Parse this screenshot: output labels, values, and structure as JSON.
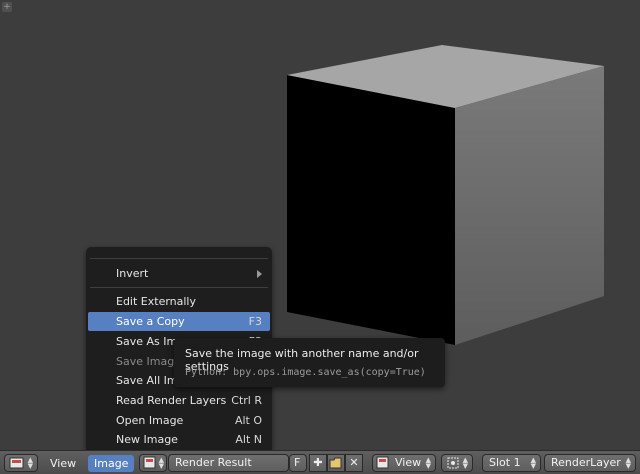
{
  "viewport": {
    "background": "#3d3d3d"
  },
  "menu": {
    "items": [
      {
        "label": "Invert",
        "shortcut": "",
        "submenu": true,
        "state": "normal"
      },
      {
        "label": "Edit Externally",
        "shortcut": "",
        "state": "normal"
      },
      {
        "label": "Save a Copy",
        "shortcut": "F3",
        "state": "active"
      },
      {
        "label": "Save As Image",
        "shortcut": "F3",
        "state": "normal"
      },
      {
        "label": "Save Image",
        "shortcut": "",
        "state": "disabled"
      },
      {
        "label": "Save All Images",
        "shortcut": "",
        "state": "normal"
      },
      {
        "label": "Read Render Layers",
        "shortcut": "Ctrl R",
        "state": "normal"
      },
      {
        "label": "Open Image",
        "shortcut": "Alt O",
        "state": "normal"
      },
      {
        "label": "New Image",
        "shortcut": "Alt N",
        "state": "normal"
      }
    ]
  },
  "tooltip": {
    "title": "Save the image with another name and/or settings",
    "python": "Python: bpy.ops.image.save_as(copy=True)"
  },
  "header": {
    "view_label": "View",
    "image_label": "Image",
    "image_name": "Render Result",
    "fake_user": "F",
    "view_mode": "View",
    "slot": "Slot 1",
    "render_layer": "RenderLayer"
  },
  "colors": {
    "accent": "#5680c2",
    "menu_bg": "#1c1c1c",
    "header_bg": "#555555"
  }
}
